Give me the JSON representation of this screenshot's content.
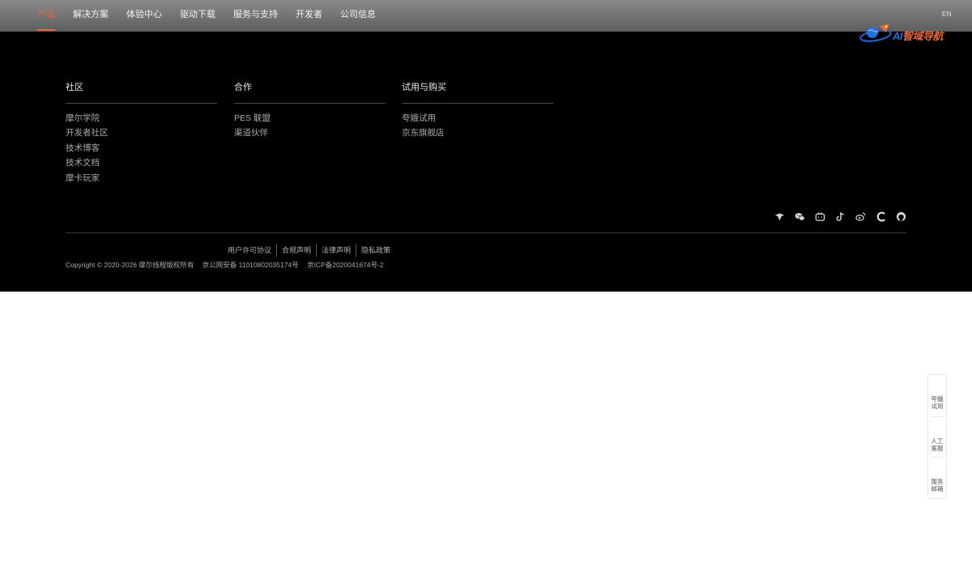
{
  "nav": {
    "items": [
      {
        "label": "产品",
        "active": true
      },
      {
        "label": "解决方案"
      },
      {
        "label": "体验中心"
      },
      {
        "label": "驱动下载"
      },
      {
        "label": "服务与支持"
      },
      {
        "label": "开发者"
      },
      {
        "label": "公司信息"
      }
    ],
    "lang": "EN",
    "accent_color": "#e5683a"
  },
  "logo": {
    "ai": "AI",
    "text": "智域导航"
  },
  "footer": {
    "columns": [
      {
        "title": "社区",
        "links": [
          "摩尔学院",
          "开发者社区",
          "技术博客",
          "技术文档",
          "摩卡玩家"
        ]
      },
      {
        "title": "合作",
        "links": [
          "PES 联盟",
          "渠道伙伴"
        ]
      },
      {
        "title": "试用与购买",
        "links": [
          "夸娥试用",
          "京东旗舰店"
        ]
      }
    ],
    "social_icons": [
      "cloud-logo-icon",
      "wechat-icon",
      "bilibili-icon",
      "tiktok-icon",
      "weibo-icon",
      "csdn-icon",
      "github-icon"
    ],
    "legal": [
      "用户许可协议",
      "合规声明",
      "法律声明",
      "隐私政策"
    ],
    "copyright": "Copyright © 2020-2026 摩尔线程版权所有",
    "beian_police": "京公网安备 11010802035174号",
    "beian_icp": "京ICP备2020041674号-2"
  },
  "floatbar": {
    "trial": [
      "夸娥",
      "试用"
    ],
    "service": [
      "人工",
      "客服"
    ],
    "mail": [
      "服务",
      "邮箱"
    ]
  }
}
